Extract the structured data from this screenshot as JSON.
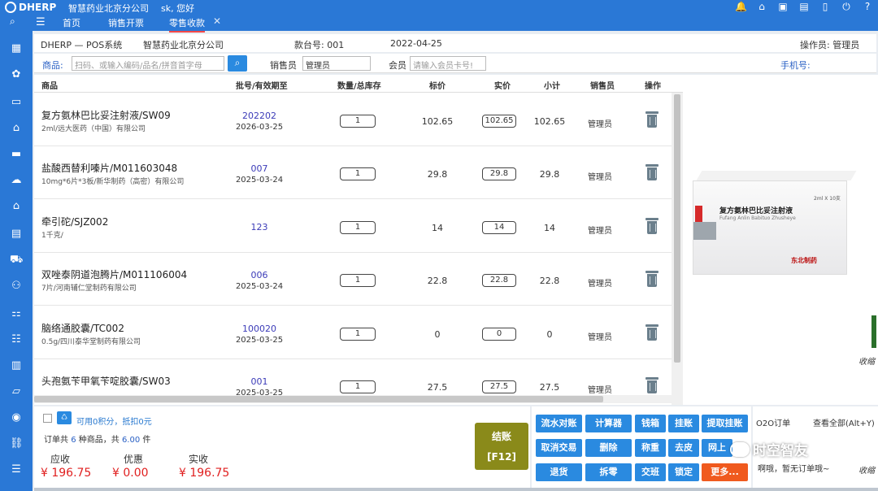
{
  "header": {
    "brand": "DHERP",
    "company": "智慧药业北京分公司",
    "greeting": "sk, 您好",
    "icons": [
      "bell-icon",
      "home-icon",
      "monitor-icon",
      "building-icon",
      "mobile-icon",
      "power-icon",
      "help-icon"
    ]
  },
  "tabs": [
    {
      "label": "首页"
    },
    {
      "label": "销售开票"
    },
    {
      "label": "零售收款"
    }
  ],
  "info": {
    "system": "DHERP — POS系统",
    "company": "智慧药业北京分公司",
    "counter_label": "款台号: 001",
    "date": "2022-04-25",
    "operator": "操作员: 管理员"
  },
  "search": {
    "product_label": "商品:",
    "product_placeholder": "扫码、或输入编码/品名/拼音首字母",
    "staff_label": "销售员",
    "staff_value": "管理员",
    "member_label": "会员",
    "member_placeholder": "请输入会员卡号!",
    "phone_label": "手机号:"
  },
  "table": {
    "headers": [
      "商品",
      "批号/有效期至",
      "数量/总库存",
      "标价",
      "实价",
      "小计",
      "销售员",
      "操作"
    ],
    "rows": [
      {
        "name": "复方氨林巴比妥注射液/SW09",
        "spec": "2ml/远大医药（中国）有限公司",
        "batch": "202202",
        "expiry": "2026-03-25",
        "qty": "1",
        "price": "102.65",
        "sale": "102.65",
        "subtotal": "102.65",
        "staff": "管理员"
      },
      {
        "name": "盐酸西替利嗪片/M011603048",
        "spec": "10mg*6片*3板/新华制药（高密）有限公司",
        "batch": "007",
        "expiry": "2025-03-24",
        "qty": "1",
        "price": "29.8",
        "sale": "29.8",
        "subtotal": "29.8",
        "staff": "管理员"
      },
      {
        "name": "牵引砣/SJZ002",
        "spec": "1千克/",
        "batch": "123",
        "expiry": "",
        "qty": "1",
        "price": "14",
        "sale": "14",
        "subtotal": "14",
        "staff": "管理员"
      },
      {
        "name": "双唑泰阴道泡腾片/M011106004",
        "spec": "7片/河南辅仁堂制药有限公司",
        "batch": "006",
        "expiry": "2025-03-24",
        "qty": "1",
        "price": "22.8",
        "sale": "22.8",
        "subtotal": "22.8",
        "staff": "管理员"
      },
      {
        "name": "脑络通胶囊/TC002",
        "spec": "0.5g/四川泰华堂制药有限公司",
        "batch": "100020",
        "expiry": "2025-03-25",
        "qty": "1",
        "price": "0",
        "sale": "0",
        "subtotal": "0",
        "staff": "管理员"
      },
      {
        "name": "头孢氨苄甲氧苄啶胶囊/SW03",
        "spec": "",
        "batch": "001",
        "expiry": "2025-03-25",
        "qty": "1",
        "price": "27.5",
        "sale": "27.5",
        "subtotal": "27.5",
        "staff": "管理员"
      }
    ]
  },
  "product_image": {
    "title": "复方氨林巴比妥注射液",
    "pinyin": "Fufang Anlin Babituo Zhusheye",
    "maker": "东北制药",
    "spec": "2ml X 10支"
  },
  "summary": {
    "points": "可用0积分，抵扣0元",
    "order_prefix": "订单共",
    "kinds": "6",
    "kinds_suffix": "种商品，共",
    "count": "6.00",
    "count_suffix": "件",
    "due_label": "应收",
    "due": "¥ 196.75",
    "discount_label": "优惠",
    "discount": "¥ 0.00",
    "paid_label": "实收",
    "paid": "¥ 196.75"
  },
  "pay_button": {
    "label": "结账",
    "key": "[F12]"
  },
  "func_buttons": [
    "流水对账",
    "计算器",
    "钱箱",
    "挂账",
    "提取挂账",
    "取消交易",
    "删除",
    "称重",
    "去皮",
    "网上",
    "退货",
    "拆零",
    "交班",
    "锁定",
    "更多..."
  ],
  "o2o": {
    "title": "O2O订单",
    "view_all": "查看全部(Alt+Y)",
    "empty": "啊哦，暂无订单哦~",
    "collapse": "收缩"
  },
  "watermark": "时空智友"
}
